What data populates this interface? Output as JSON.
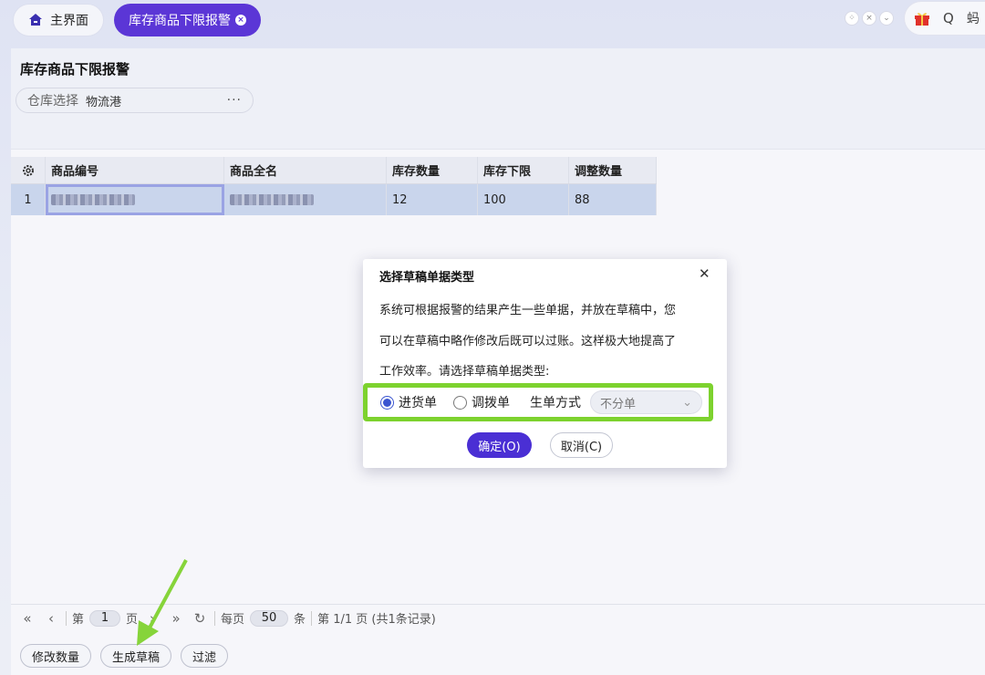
{
  "tabs": {
    "home_label": "主界面",
    "active_label": "库存商品下限报警"
  },
  "toolbar": {
    "search_glyph": "Q",
    "partial_text": "蚂"
  },
  "page": {
    "title": "库存商品下限报警",
    "warehouse_label": "仓库选择",
    "warehouse_value": "物流港",
    "warehouse_more": "···"
  },
  "table": {
    "columns": [
      "商品编号",
      "商品全名",
      "库存数量",
      "库存下限",
      "调整数量"
    ],
    "rows": [
      {
        "index": "1",
        "stock": "12",
        "lower_limit": "100",
        "adjust": "88"
      }
    ]
  },
  "pager": {
    "page_prefix": "第",
    "page_value": "1",
    "page_suffix": "页",
    "per_page_prefix": "每页",
    "per_page_value": "50",
    "per_page_suffix": "条",
    "summary": "第 1/1 页 (共1条记录)"
  },
  "buttons": {
    "edit_qty": "修改数量",
    "gen_draft": "生成草稿",
    "filter": "过滤"
  },
  "modal": {
    "title": "选择草稿单据类型",
    "text_lines": [
      "系统可根据报警的结果产生一些单据，并放在草稿中，您",
      "可以在草稿中略作修改后既可以过账。这样极大地提高了",
      "工作效率。请选择草稿单据类型:"
    ],
    "radio_purchase": "进货单",
    "radio_transfer": "调拨单",
    "selected": "进货单",
    "mode_label": "生单方式",
    "mode_value": "不分单",
    "ok": "确定(O)",
    "cancel": "取消(C)"
  },
  "colors": {
    "accent": "#5b36d6",
    "highlight": "#7dd22e"
  }
}
